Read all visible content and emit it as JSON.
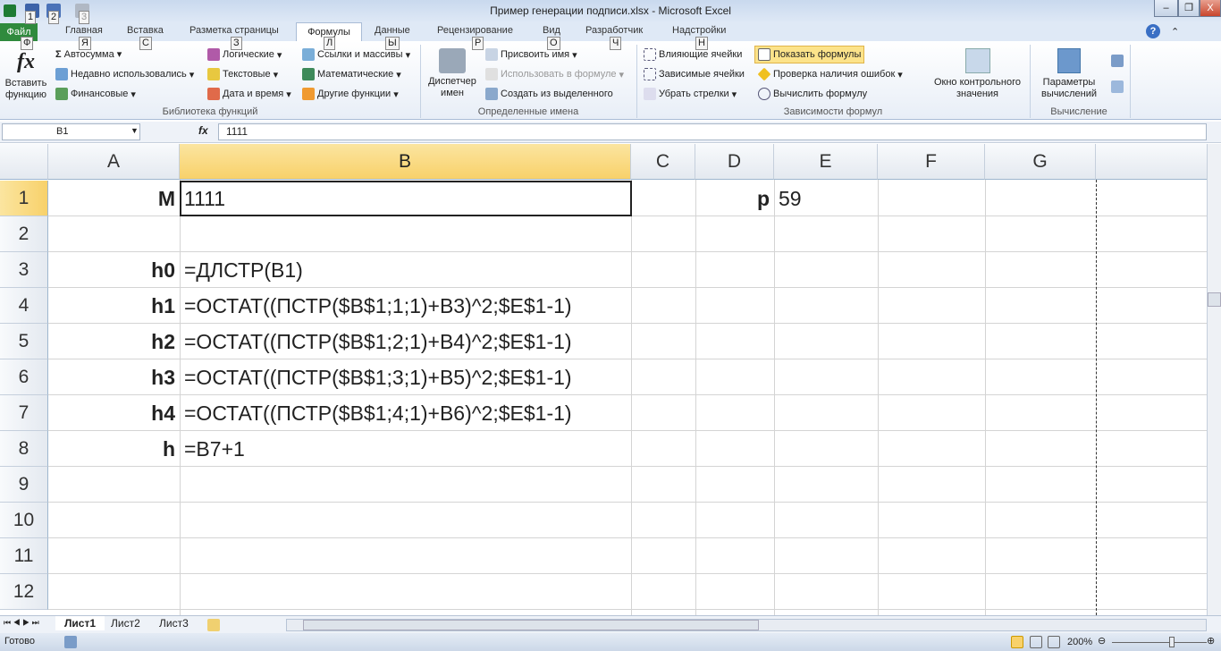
{
  "window": {
    "title": "Пример генерации подписи.xlsx - Microsoft Excel",
    "minimize": "–",
    "restore": "❐",
    "close": "X"
  },
  "quick_access": {
    "keytips": [
      "1",
      "2",
      "3"
    ]
  },
  "tabs": [
    {
      "label": "Файл",
      "key": "Ф"
    },
    {
      "label": "Главная",
      "key": "Я"
    },
    {
      "label": "Вставка",
      "key": "С"
    },
    {
      "label": "Разметка страницы",
      "key": "З"
    },
    {
      "label": "Формулы",
      "key": "Л"
    },
    {
      "label": "Данные",
      "key": "Ы"
    },
    {
      "label": "Рецензирование",
      "key": "Р"
    },
    {
      "label": "Вид",
      "key": "О"
    },
    {
      "label": "Разработчик",
      "key": "Ч"
    },
    {
      "label": "Надстройки",
      "key": "Н"
    }
  ],
  "ribbon": {
    "insert_function": "Вставить функцию",
    "library": [
      "Автосумма",
      "Недавно использовались",
      "Финансовые",
      "Логические",
      "Текстовые",
      "Дата и время",
      "Ссылки и массивы",
      "Математические",
      "Другие функции"
    ],
    "library_label": "Библиотека функций",
    "name_manager": "Диспетчер имен",
    "names": [
      "Присвоить имя",
      "Использовать в формуле",
      "Создать из выделенного"
    ],
    "names_label": "Определенные имена",
    "audit": [
      "Влияющие ячейки",
      "Зависимые ячейки",
      "Убрать стрелки",
      "Показать формулы",
      "Проверка наличия ошибок",
      "Вычислить формулу"
    ],
    "audit_label": "Зависимости формул",
    "watch": "Окно контрольного значения",
    "calc_options": "Параметры вычислений",
    "calc_label": "Вычисление"
  },
  "formula_bar": {
    "name_box": "B1",
    "fx": "fx",
    "value": "1111"
  },
  "columns": [
    "A",
    "B",
    "C",
    "D",
    "E",
    "F",
    "G"
  ],
  "rows": [
    "1",
    "2",
    "3",
    "4",
    "5",
    "6",
    "7",
    "8",
    "9",
    "10",
    "11",
    "12"
  ],
  "cells": {
    "A1": "M",
    "B1": "1111",
    "D1": "p",
    "E1": "59",
    "A3": "h0",
    "B3": "=ДЛСТР(B1)",
    "A4": "h1",
    "B4": "=ОСТАТ((ПСТР($B$1;1;1)+B3)^2;$E$1-1)",
    "A5": "h2",
    "B5": "=ОСТАТ((ПСТР($B$1;2;1)+B4)^2;$E$1-1)",
    "A6": "h3",
    "B6": "=ОСТАТ((ПСТР($B$1;3;1)+B5)^2;$E$1-1)",
    "A7": "h4",
    "B7": "=ОСТАТ((ПСТР($B$1;4;1)+B6)^2;$E$1-1)",
    "A8": "h",
    "B8": "=B7+1"
  },
  "sheets": [
    "Лист1",
    "Лист2",
    "Лист3"
  ],
  "status": {
    "ready": "Готово",
    "zoom": "200%"
  }
}
